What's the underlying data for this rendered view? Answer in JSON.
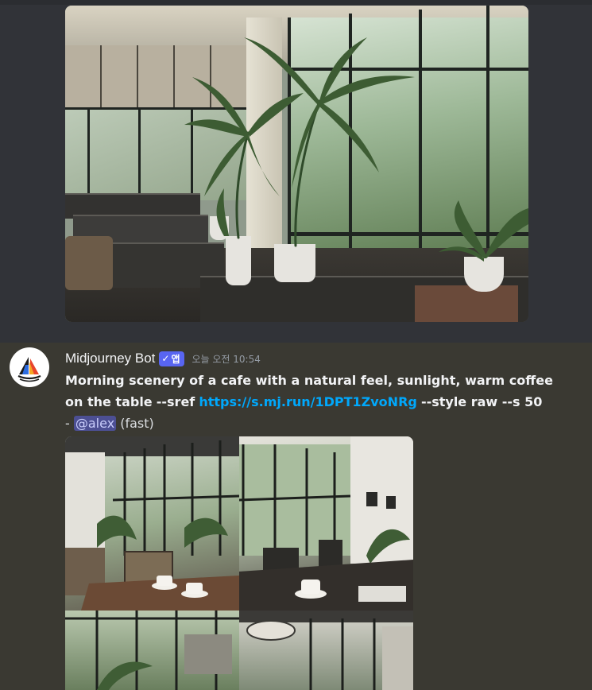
{
  "previous_message": {
    "image_alt": "cafe interior with large windows and palm plants"
  },
  "message": {
    "author": "Midjourney Bot",
    "badge": {
      "check": "✓",
      "label": "앱"
    },
    "timestamp": "오늘 오전 10:54",
    "prompt": "Morning scenery of a cafe with a natural feel, sunlight, warm coffee on the table",
    "sref_flag": "--sref",
    "sref_link": "https://s.mj.run/1DPT1ZvoNRg",
    "params": "--style raw --s 50",
    "separator": "-",
    "mention": "@alex",
    "speed": "(fast)",
    "image_alt": "2x2 grid of cafe images with coffee cups"
  },
  "colors": {
    "background": "#313338",
    "highlight": "#3a3932",
    "link": "#00a8fc",
    "badge": "#5865f2",
    "mention_bg": "#4c4f93"
  },
  "icons": {
    "avatar": "sailboat-logo-icon",
    "badge": "checkmark-icon"
  }
}
